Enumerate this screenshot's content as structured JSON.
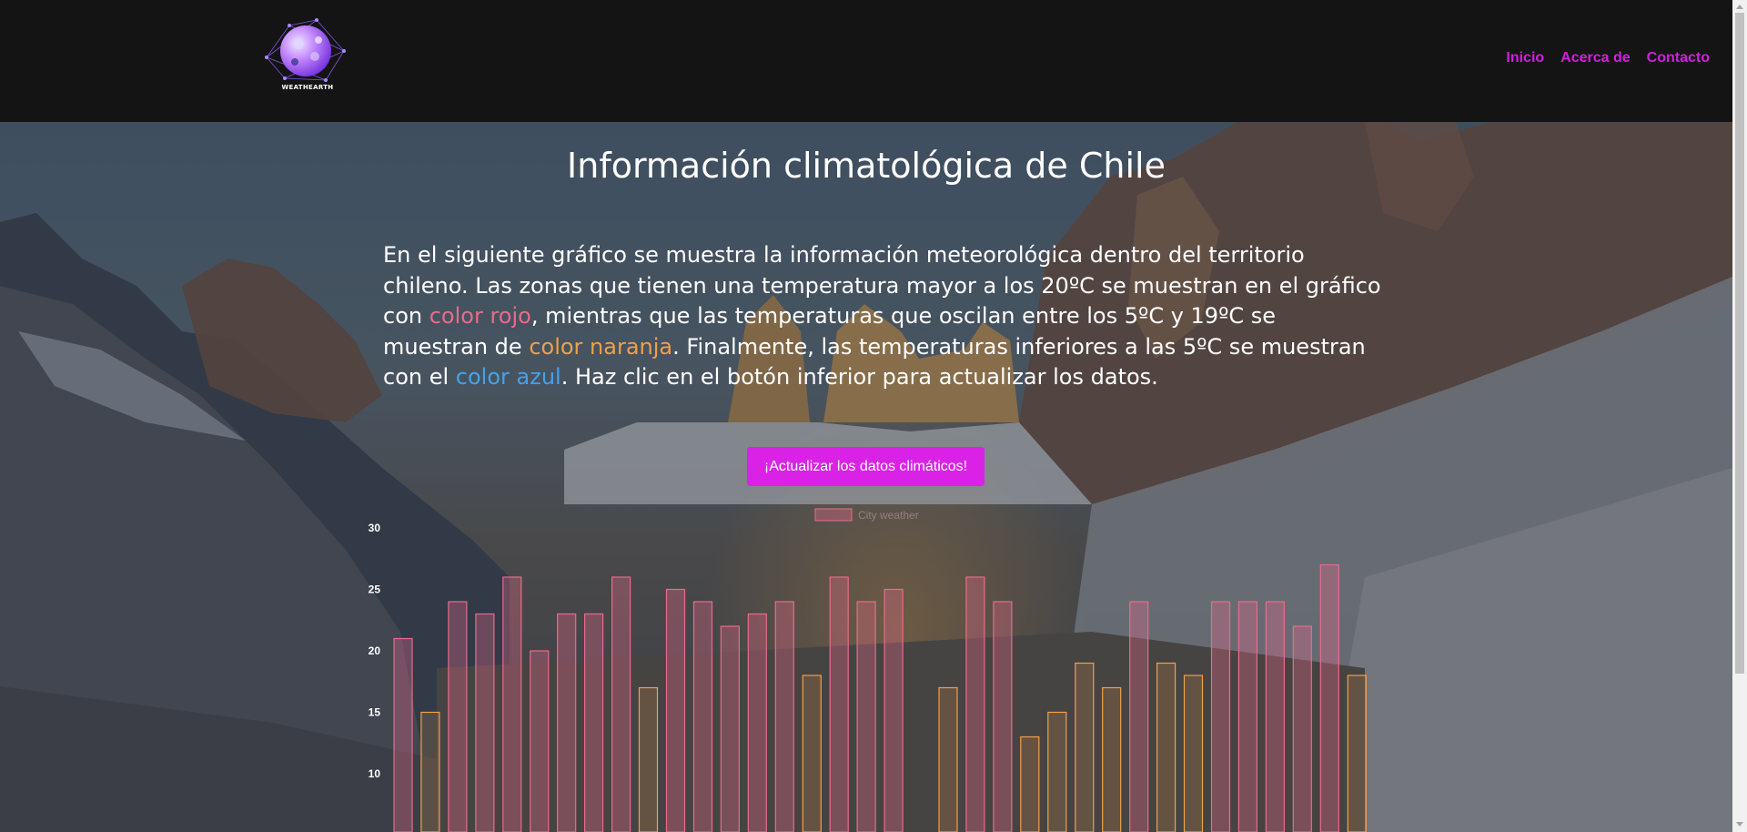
{
  "header": {
    "logo_text": "WEATHEARTH",
    "nav": [
      {
        "label": "Inicio"
      },
      {
        "label": "Acerca de"
      },
      {
        "label": "Contacto"
      }
    ]
  },
  "hero": {
    "title": "Información climatológica de Chile",
    "intro_part1": "En el siguiente gráfico se muestra la información meteorológica dentro del territorio chileno. Las zonas que tienen una temperatura mayor a los 20ºC se muestran en el gráfico con ",
    "red_label": "color rojo",
    "intro_part2": ", mientras que las temperaturas que oscilan entre los 5ºC y 19ºC se muestran de ",
    "orange_label": "color naranja",
    "intro_part3": ". Finalmente, las temperaturas inferiores a las 5ºC se muestran con el ",
    "blue_label": "color azul",
    "intro_part4": ". Haz clic en el botón inferior para actualizar los datos.",
    "update_button": "¡Actualizar los datos climáticos!"
  },
  "colors": {
    "accent": "#da22e6",
    "nav": "#d21fe0",
    "hot": "#ea6a8c",
    "warm": "#f0a04a",
    "cold": "#44a2ea"
  },
  "chart_data": {
    "type": "bar",
    "legend": [
      "City weather"
    ],
    "legend_position": "top",
    "y_ticks": [
      30,
      25,
      20,
      15,
      10
    ],
    "ylim": [
      5,
      30
    ],
    "values": [
      21,
      15,
      24,
      23,
      26,
      20,
      23,
      23,
      26,
      17,
      25,
      24,
      22,
      23,
      24,
      18,
      26,
      24,
      25,
      null,
      17,
      26,
      24,
      13,
      15,
      19,
      17,
      24,
      19,
      18,
      24,
      24,
      24,
      22,
      27,
      18
    ],
    "hot_threshold": 20
  }
}
